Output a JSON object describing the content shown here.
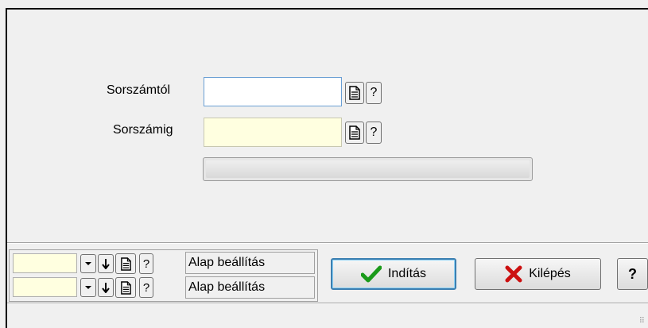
{
  "form": {
    "from_label": "Sorszámtól",
    "to_label": "Sorszámig",
    "from_value": "",
    "to_value": "",
    "help_glyph": "?",
    "progress_fraction": 0.0
  },
  "settings": {
    "rows": [
      {
        "value": "",
        "label": "Alap beállítás"
      },
      {
        "value": "",
        "label": "Alap beállítás"
      }
    ],
    "help_glyph": "?"
  },
  "actions": {
    "start_label": "Indítás",
    "exit_label": "Kilépés",
    "help_label": "?"
  },
  "colors": {
    "window_bg": "#f0f0f0",
    "from_field_bg": "#ffffff",
    "to_field_bg": "#ffffe0",
    "start_check": "#1a9a1a",
    "exit_cross": "#cc1010",
    "progress_fill": "#06b025"
  },
  "icons": {
    "document": "document-icon",
    "dropdown": "chevron-down-icon",
    "down_arrow": "arrow-down-icon",
    "checkmark": "checkmark-icon",
    "cross": "cross-icon"
  }
}
